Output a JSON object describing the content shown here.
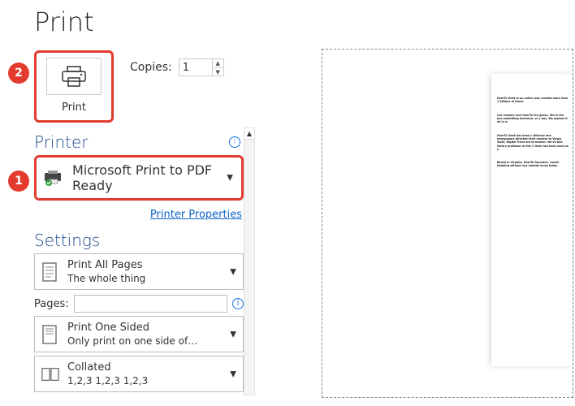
{
  "title": "Print",
  "print_button_label": "Print",
  "copies": {
    "label": "Copies:",
    "value": "1"
  },
  "badges": {
    "1": "1",
    "2": "2"
  },
  "printer": {
    "section_title": "Printer",
    "name": "Microsoft Print to PDF",
    "status": "Ready",
    "properties_link": "Printer Properties"
  },
  "settings": {
    "title": "Settings",
    "pages_range": {
      "label": "Print All Pages",
      "sub": "The whole thing"
    },
    "pages_row": {
      "label": "Pages:",
      "value": ""
    },
    "sides": {
      "label": "Print One Sided",
      "sub": "Only print on one side of…"
    },
    "collate": {
      "label": "Collated",
      "sub": "1,2,3    1,2,3    1,2,3"
    }
  },
  "preview": {
    "paragraphs": [
      "How-To Geek is an online was created more than 1 billions of times.",
      "Our readers love How-To the geeks. We're the peo something technical, or y buy. We explain it all in si",
      "How-To Geek has been n Alliance and newspapers directed their readers to Verge, Slate, Digital Trend we've broken. We've bee theory professor at the C Geek has been used as a",
      "Based in Virginia, How-To founders, Lowell Hedding without any outside inves today."
    ]
  }
}
